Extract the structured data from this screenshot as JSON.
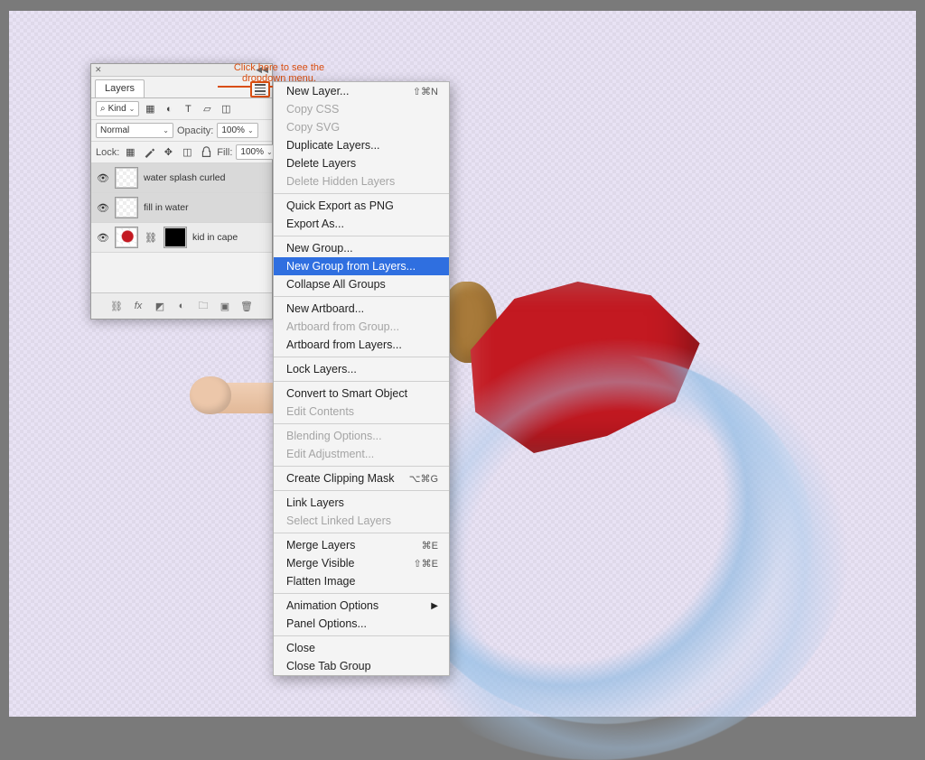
{
  "annotation": {
    "line1": "Click here to see the",
    "line2": "dropdown menu."
  },
  "panel": {
    "tab": "Layers",
    "kindFilter": "Kind",
    "blendMode": "Normal",
    "opacityLabel": "Opacity:",
    "opacityValue": "100%",
    "lockLabel": "Lock:",
    "fillLabel": "Fill:",
    "fillValue": "100%",
    "layers": [
      {
        "name": "water splash curled"
      },
      {
        "name": "fill in water"
      },
      {
        "name": "kid in cape"
      }
    ]
  },
  "menu": {
    "items": [
      {
        "label": "New Layer...",
        "shortcut": "⇧⌘N"
      },
      {
        "label": "Copy CSS",
        "disabled": true
      },
      {
        "label": "Copy SVG",
        "disabled": true
      },
      {
        "label": "Duplicate Layers..."
      },
      {
        "label": "Delete Layers"
      },
      {
        "label": "Delete Hidden Layers",
        "disabled": true
      },
      {
        "sep": true
      },
      {
        "label": "Quick Export as PNG"
      },
      {
        "label": "Export As..."
      },
      {
        "sep": true
      },
      {
        "label": "New Group..."
      },
      {
        "label": "New Group from Layers...",
        "selected": true
      },
      {
        "label": "Collapse All Groups"
      },
      {
        "sep": true
      },
      {
        "label": "New Artboard..."
      },
      {
        "label": "Artboard from Group...",
        "disabled": true
      },
      {
        "label": "Artboard from Layers..."
      },
      {
        "sep": true
      },
      {
        "label": "Lock Layers..."
      },
      {
        "sep": true
      },
      {
        "label": "Convert to Smart Object"
      },
      {
        "label": "Edit Contents",
        "disabled": true
      },
      {
        "sep": true
      },
      {
        "label": "Blending Options...",
        "disabled": true
      },
      {
        "label": "Edit Adjustment...",
        "disabled": true
      },
      {
        "sep": true
      },
      {
        "label": "Create Clipping Mask",
        "shortcut": "⌥⌘G"
      },
      {
        "sep": true
      },
      {
        "label": "Link Layers"
      },
      {
        "label": "Select Linked Layers",
        "disabled": true
      },
      {
        "sep": true
      },
      {
        "label": "Merge Layers",
        "shortcut": "⌘E"
      },
      {
        "label": "Merge Visible",
        "shortcut": "⇧⌘E"
      },
      {
        "label": "Flatten Image"
      },
      {
        "sep": true
      },
      {
        "label": "Animation Options",
        "submenu": true
      },
      {
        "label": "Panel Options..."
      },
      {
        "sep": true
      },
      {
        "label": "Close"
      },
      {
        "label": "Close Tab Group"
      }
    ]
  }
}
